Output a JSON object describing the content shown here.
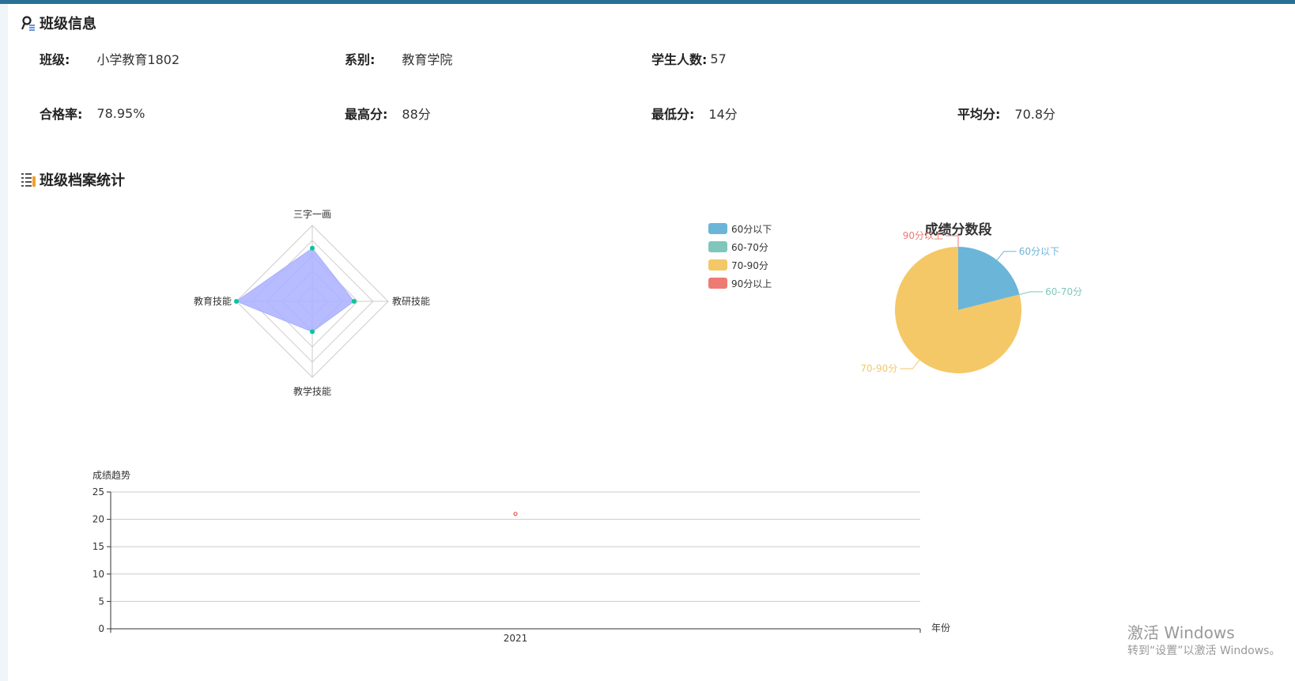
{
  "class_info": {
    "title": "班级信息",
    "class": {
      "label": "班级:",
      "value": "小学教育1802"
    },
    "department": {
      "label": "系别:",
      "value": "教育学院"
    },
    "students": {
      "label": "学生人数:",
      "value": "57"
    },
    "pass_rate": {
      "label": "合格率:",
      "value": "78.95%"
    },
    "max": {
      "label": "最高分:",
      "value": "88分"
    },
    "min": {
      "label": "最低分:",
      "value": "14分"
    },
    "avg": {
      "label": "平均分:",
      "value": "70.8分"
    }
  },
  "archive": {
    "title": "班级档案统计"
  },
  "colors": {
    "header_bar": "#2a7096",
    "radar_fill": "#a9b0ff",
    "radar_point": "#00c896",
    "pie_below60": "#6bb5d9",
    "pie_60_70": "#7fc7ba",
    "pie_70_90": "#f4c866",
    "pie_above90": "#ee7a74",
    "line_point": "#e05a50"
  },
  "chart_data": [
    {
      "type": "radar",
      "indicators": [
        "三字一画",
        "教研技能",
        "教学技能",
        "教育技能"
      ],
      "max": 100,
      "values": [
        70,
        55,
        40,
        100
      ]
    },
    {
      "type": "pie",
      "title": "成绩分数段",
      "legend": [
        "60分以下",
        "60-70分",
        "70-90分",
        "90分以上"
      ],
      "legend_position": "left",
      "slices": [
        {
          "label": "60分以下",
          "value": 12
        },
        {
          "label": "60-70分",
          "value": 0
        },
        {
          "label": "70-90分",
          "value": 45
        },
        {
          "label": "90分以上",
          "value": 0
        }
      ]
    },
    {
      "type": "scatter",
      "ylabel": "成绩趋势",
      "xlabel": "年份",
      "categories": [
        "2021"
      ],
      "values": [
        21
      ],
      "ylim": [
        0,
        25
      ],
      "yticks": [
        0,
        5,
        10,
        15,
        20,
        25
      ],
      "grid": true
    }
  ],
  "watermark": {
    "line1": "激活 Windows",
    "line2": "转到“设置”以激活 Windows。"
  }
}
